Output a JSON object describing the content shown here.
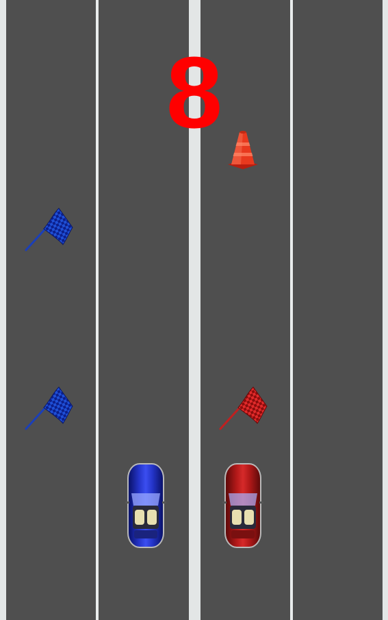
{
  "game": {
    "score": "8",
    "players": [
      {
        "color": "blue",
        "hex": "#1a2aa8"
      },
      {
        "color": "red",
        "hex": "#c41a1a"
      }
    ],
    "objects": [
      {
        "type": "checkered-flag",
        "color": "blue"
      },
      {
        "type": "checkered-flag",
        "color": "blue"
      },
      {
        "type": "traffic-cone",
        "color": "red"
      },
      {
        "type": "checkered-flag",
        "color": "red"
      }
    ]
  },
  "colors": {
    "background": "#e3e6e6",
    "road": "#4f4f4f",
    "lane_divider": "#e9ecec",
    "score": "#ff0000"
  }
}
